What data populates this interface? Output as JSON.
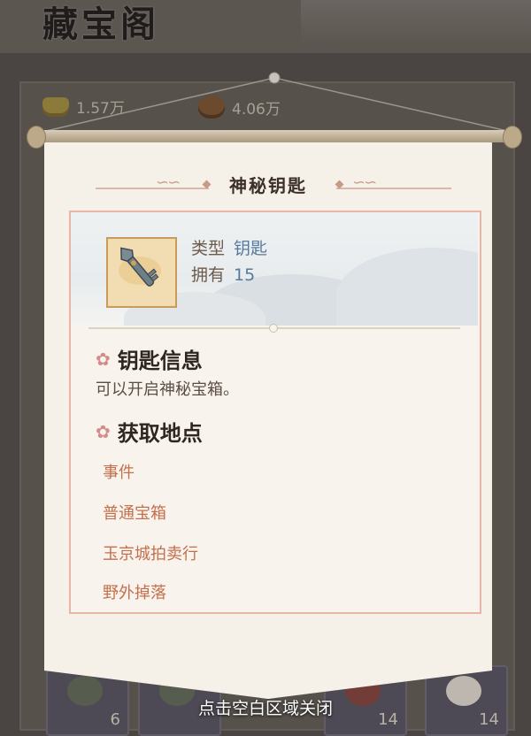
{
  "background": {
    "title": "藏宝阁",
    "currency": [
      {
        "icon": "gold-ingot-icon",
        "value": "1.57万"
      },
      {
        "icon": "coin-pouch-icon",
        "value": "4.06万"
      }
    ],
    "slots": [
      {
        "count": "6"
      },
      {
        "count": ""
      },
      {
        "count": "14"
      },
      {
        "count": "14"
      }
    ]
  },
  "popup": {
    "title": "神秘钥匙",
    "item": {
      "icon": "key-icon",
      "type_label": "类型",
      "type_value": "钥匙",
      "owned_label": "拥有",
      "owned_value": "15"
    },
    "info": {
      "heading": "钥匙信息",
      "description": "可以开启神秘宝箱。"
    },
    "sources": {
      "heading": "获取地点",
      "items": [
        "事件",
        "普通宝箱",
        "玉京城拍卖行",
        "野外掉落"
      ]
    }
  },
  "hint": "点击空白区域关闭",
  "colors": {
    "source_link": "#c56f4c",
    "meta_value": "#557a9c",
    "frame_border": "#e8b5a8"
  }
}
